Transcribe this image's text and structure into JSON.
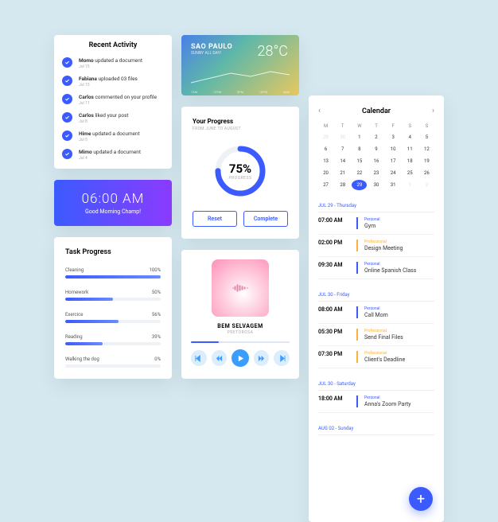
{
  "activity": {
    "title": "Recent Activity",
    "items": [
      {
        "user": "Momo",
        "action": "updated a document",
        "date": "Jul 15"
      },
      {
        "user": "Fabiana",
        "action": "uploaded 03 files",
        "date": "Jul 15"
      },
      {
        "user": "Carlos",
        "action": "commented on your profile",
        "date": "Jul 11"
      },
      {
        "user": "Carlos",
        "action": "liked your post",
        "date": "Jul 8"
      },
      {
        "user": "Hime",
        "action": "updated a document",
        "date": "Jul 5"
      },
      {
        "user": "Mimo",
        "action": "updated a document",
        "date": "Jul 4"
      }
    ]
  },
  "greeting": {
    "time": "06:00 AM",
    "message": "Good Morning Champ!"
  },
  "tasks": {
    "title": "Task Progress",
    "items": [
      {
        "name": "Cleaning",
        "pct": "100%",
        "val": 100
      },
      {
        "name": "Homework",
        "pct": "50%",
        "val": 50
      },
      {
        "name": "Exercice",
        "pct": "56%",
        "val": 56
      },
      {
        "name": "Reading",
        "pct": "39%",
        "val": 39
      },
      {
        "name": "Walking the dog",
        "pct": "0%",
        "val": 0
      }
    ]
  },
  "weather": {
    "city": "SAO PAULO",
    "description": "SUNNY ALL DAY!",
    "temp": "28°C",
    "labels": [
      "7AM",
      "12PM",
      "5PM",
      "10PM",
      "3AM"
    ]
  },
  "progress": {
    "title": "Your Progress",
    "subtitle": "FROM JUNE TO AUGUST",
    "percent": "75%",
    "label": "PROGRESS",
    "reset": "Reset",
    "complete": "Complete"
  },
  "music": {
    "track": "BEM SELVAGEM",
    "artist": "PRETOROSA"
  },
  "calendar": {
    "title": "Calendar",
    "dow": [
      "M",
      "T",
      "W",
      "T",
      "F",
      "S",
      "S"
    ],
    "days": [
      {
        "n": 29,
        "muted": true
      },
      {
        "n": 30,
        "muted": true
      },
      {
        "n": 1
      },
      {
        "n": 2
      },
      {
        "n": 3
      },
      {
        "n": 4
      },
      {
        "n": 5
      },
      {
        "n": 6
      },
      {
        "n": 7
      },
      {
        "n": 8
      },
      {
        "n": 9
      },
      {
        "n": 10
      },
      {
        "n": 11
      },
      {
        "n": 12
      },
      {
        "n": 13
      },
      {
        "n": 14
      },
      {
        "n": 15
      },
      {
        "n": 16
      },
      {
        "n": 17
      },
      {
        "n": 18
      },
      {
        "n": 19
      },
      {
        "n": 20
      },
      {
        "n": 21
      },
      {
        "n": 22
      },
      {
        "n": 23
      },
      {
        "n": 24
      },
      {
        "n": 25
      },
      {
        "n": 26
      },
      {
        "n": 27
      },
      {
        "n": 28
      },
      {
        "n": 29,
        "today": true
      },
      {
        "n": 30
      },
      {
        "n": 31
      },
      {
        "n": 1,
        "muted": true
      },
      {
        "n": 2,
        "muted": true
      }
    ],
    "sections": [
      {
        "label": "JUL 29 - Thursday",
        "events": [
          {
            "t": "07:00 AM",
            "cat": "Personal",
            "cls": "pers",
            "name": "Gym"
          },
          {
            "t": "02:00 PM",
            "cat": "Professional",
            "cls": "prof",
            "name": "Design Meeting"
          },
          {
            "t": "09:30 AM",
            "cat": "Personal",
            "cls": "pers",
            "name": "Online Spanish Class"
          }
        ]
      },
      {
        "label": "JUL 30 - Friday",
        "events": [
          {
            "t": "08:00 AM",
            "cat": "Personal",
            "cls": "pers",
            "name": "Call Mom"
          },
          {
            "t": "05:30 PM",
            "cat": "Professional",
            "cls": "prof",
            "name": "Send Final Files"
          },
          {
            "t": "07:30 PM",
            "cat": "Professional",
            "cls": "prof",
            "name": "Client's Deadline"
          }
        ]
      },
      {
        "label": "JUL 30 - Saturday",
        "events": [
          {
            "t": "18:00 AM",
            "cat": "Personal",
            "cls": "pers",
            "name": "Anna's Zoom Party"
          }
        ]
      },
      {
        "label": "AUG 02 - Sunday",
        "events": []
      }
    ]
  }
}
